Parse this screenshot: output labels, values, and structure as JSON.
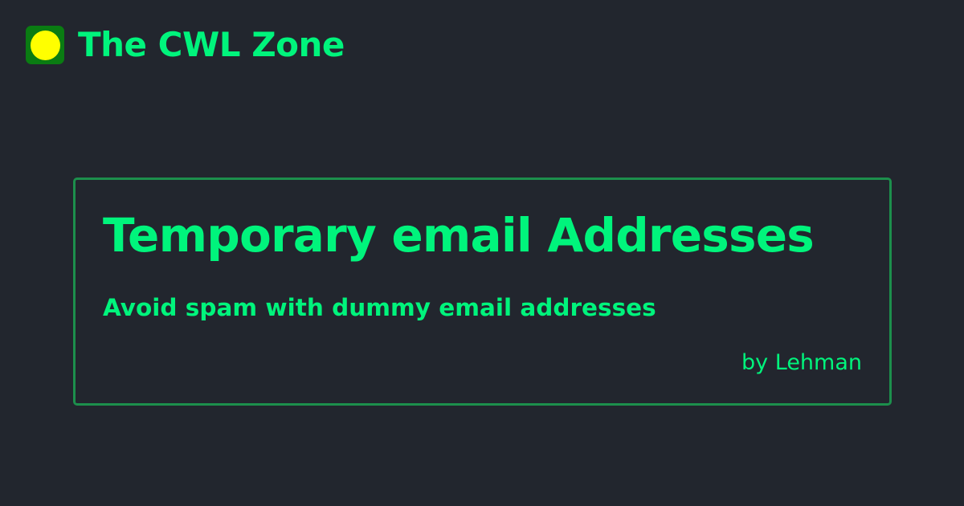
{
  "site": {
    "title": "The CWL Zone",
    "logo_icon": "yellow-dot-icon"
  },
  "card": {
    "title": "Temporary email Addresses",
    "subtitle": "Avoid spam with dummy email addresses",
    "author": "by Lehman"
  },
  "colors": {
    "background": "#22262e",
    "accent": "#00f47c",
    "card_border": "#1c8f4c",
    "logo_bg": "#0a7c12",
    "logo_dot": "#ffff00"
  }
}
